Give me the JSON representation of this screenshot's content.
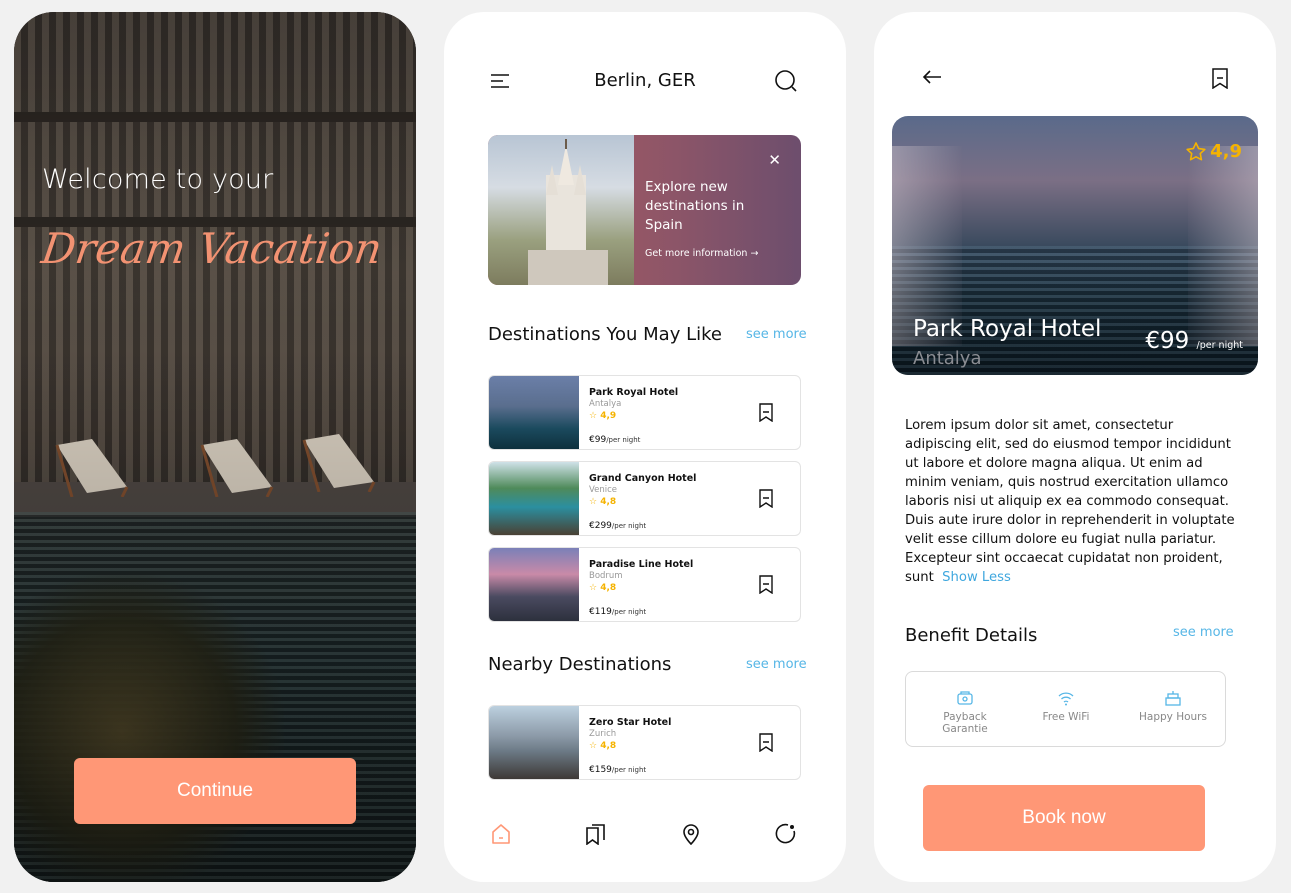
{
  "welcome_screen": {
    "welcome_text": "Welcome to your",
    "headline": "Dream Vacation",
    "continue_label": "Continue"
  },
  "home_screen": {
    "location": "Berlin, GER",
    "promo": {
      "text": "Explore new destinations in Spain",
      "link_label": "Get more information"
    },
    "destinations": {
      "title": "Destinations You May Like",
      "see_more": "see more",
      "items": [
        {
          "name": "Park Royal Hotel",
          "city": "Antalya",
          "rating": "4,9",
          "price": "€99",
          "per": "/per night"
        },
        {
          "name": "Grand Canyon Hotel",
          "city": "Venice",
          "rating": "4,8",
          "price": "€299",
          "per": "/per night"
        },
        {
          "name": "Paradise Line Hotel",
          "city": "Bodrum",
          "rating": "4,8",
          "price": "€119",
          "per": "/per night"
        }
      ]
    },
    "nearby": {
      "title": "Nearby Destinations",
      "see_more": "see more",
      "items": [
        {
          "name": "Zero Star Hotel",
          "city": "Zurich",
          "rating": "4,8",
          "price": "€159",
          "per": "/per night"
        }
      ]
    },
    "tabs": [
      "home-icon",
      "bookmarks-icon",
      "map-pin-icon",
      "profile-icon"
    ]
  },
  "detail_screen": {
    "rating": "4,9",
    "hotel_name": "Park Royal Hotel",
    "city": "Antalya",
    "price": "€99",
    "per": "/per night",
    "description": "Lorem ipsum dolor sit amet, consectetur adipiscing elit, sed do eiusmod tempor incididunt ut labore et dolore magna aliqua. Ut enim ad minim veniam, quis nostrud exercitation ullamco laboris nisi ut aliquip ex ea commodo consequat.",
    "description2": "Duis aute irure dolor in reprehenderit in voluptate velit esse cillum dolore eu fugiat nulla pariatur. Excepteur sint occaecat cupidatat non proident, sunt",
    "show_less": "Show Less",
    "benefit_title": "Benefit Details",
    "benefit_see_more": "see more",
    "benefits": [
      {
        "label": "Payback Garantie",
        "icon": "payback-icon"
      },
      {
        "label": "Free WiFi",
        "icon": "wifi-icon"
      },
      {
        "label": "Happy Hours",
        "icon": "cake-icon"
      }
    ],
    "book_label": "Book now"
  },
  "colors": {
    "accent": "#ff9776",
    "headline": "#f29272",
    "link": "#56b6e6",
    "rating": "#f5b301"
  }
}
